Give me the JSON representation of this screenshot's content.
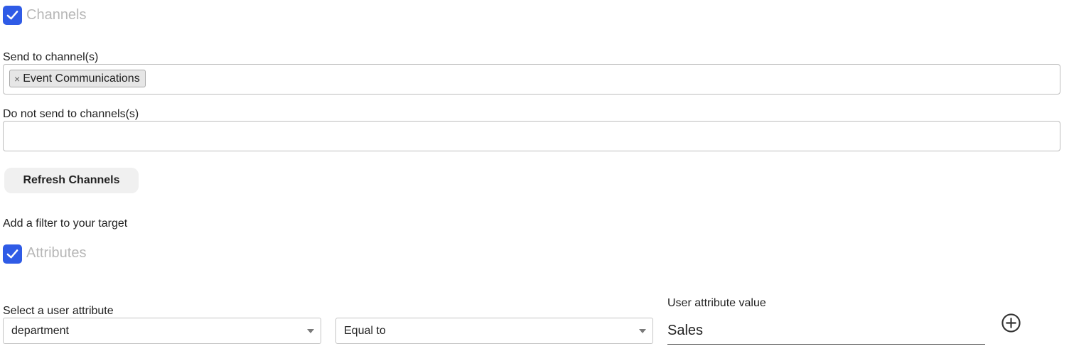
{
  "channels_section": {
    "title": "Channels",
    "checked": true,
    "send_label": "Send to channel(s)",
    "send_tags": [
      {
        "label": "Event Communications",
        "remove": "×"
      }
    ],
    "exclude_label": "Do not send to channels(s)",
    "refresh_button": "Refresh Channels"
  },
  "filter": {
    "heading": "Add a filter to your target",
    "attributes_title": "Attributes",
    "attributes_checked": true,
    "attribute_select_label": "Select a user attribute",
    "attribute_select_value": "department",
    "operator_select_value": "Equal to",
    "value_label": "User attribute value",
    "value_input": "Sales"
  },
  "colors": {
    "checkbox": "#2f5be6",
    "section_title": "#b7b7b7"
  },
  "icons": {
    "checkbox": "checkmark-icon",
    "add": "plus-circle-icon",
    "dropdown": "caret-down-icon"
  }
}
